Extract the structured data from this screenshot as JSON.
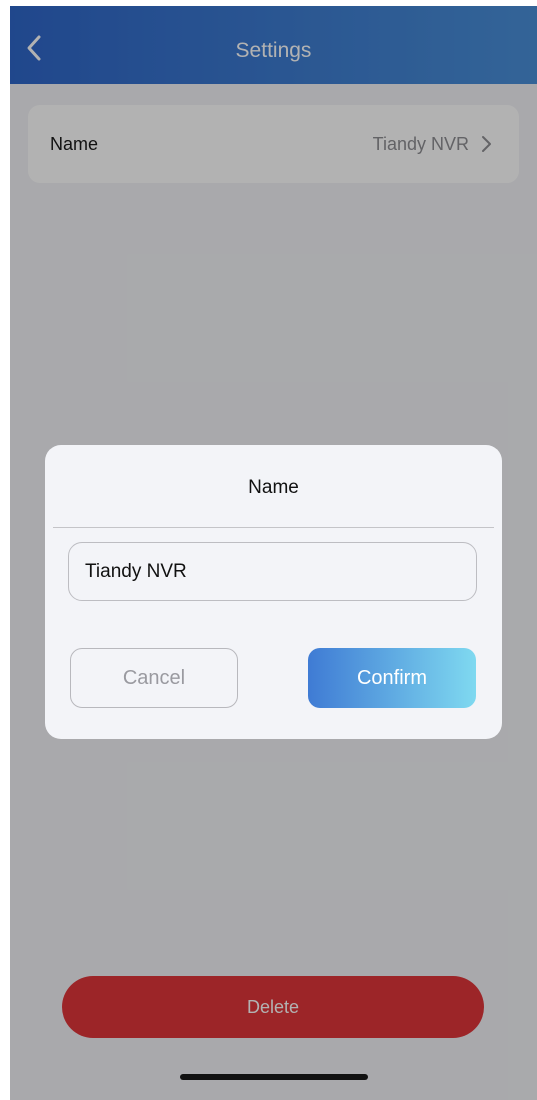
{
  "header": {
    "title": "Settings",
    "back_icon": "chevron-left-icon"
  },
  "settings": {
    "name_row": {
      "label": "Name",
      "value": "Tiandy NVR",
      "chevron_icon": "chevron-right-icon"
    }
  },
  "delete_button": {
    "label": "Delete"
  },
  "dialog": {
    "title": "Name",
    "input_value": "Tiandy NVR",
    "cancel_label": "Cancel",
    "confirm_label": "Confirm"
  },
  "colors": {
    "header_start": "#2f66c9",
    "header_end": "#4a90d9",
    "delete": "#e0353a",
    "confirm_start": "#3f7bd4",
    "confirm_end": "#7fd9f0"
  }
}
